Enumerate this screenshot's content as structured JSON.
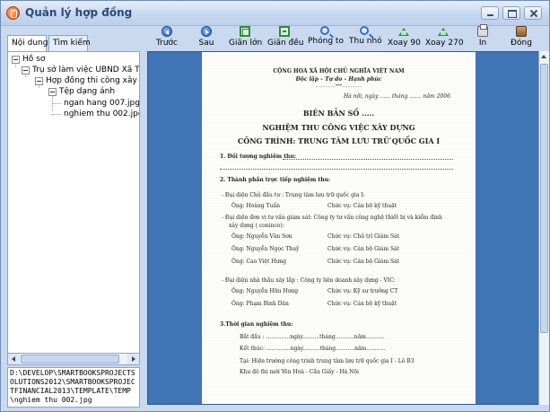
{
  "window": {
    "title": "Quản lý hợp đồng"
  },
  "tabs": [
    "Nội dung",
    "Tìm kiếm"
  ],
  "tree": {
    "root": "Hồ sơ",
    "level1": "Trụ sở làm việc UBND Xã Thần",
    "level2": "Hợp đồng thi công xây dựn",
    "level3": "Tệp dạng ảnh",
    "files": [
      "ngan hang 007.jpg",
      "nghiem thu 002.jpg"
    ]
  },
  "path_text": "D:\\DEVELOP\\SMARTBOOKSPROJECTSOLUTIONS2012\\SMARTBOOKSPROJECTFINANCIAL2013\\TEMPLATE\\TEMP\\nghiem thu 002.jpg",
  "toolbar": {
    "prev": "Trước",
    "next": "Sau",
    "zoom_in": "Giãn lớn",
    "fit": "Giãn đều",
    "magnify": "Phóng to",
    "shrink": "Thu nhỏ",
    "rotate90": "Xoay 90",
    "rotate270": "Xoay 270",
    "print": "In",
    "close": "Đóng"
  },
  "document": {
    "country": "CỘNG HOÀ XÃ HỘI CHỦ NGHĨA VIỆT NAM",
    "motto": "Độc lập – Tự do – Hạnh phúc",
    "motto_line": "..............***..............",
    "date": "Hà nội, ngày ...... tháng ....... năm 2006",
    "heading": "BIÊN BẢN SỐ .....",
    "subheading": "NGHIỆM THU CÔNG VIỆC XÂY DỰNG",
    "project": "CÔNG TRÌNH: TRUNG TÂM LƯU TRỮ QUỐC GIA I",
    "s1": "1. Đối tượng nghiệm thu:",
    "s2": "2. Thành phần trực tiếp nghiệm thu:",
    "owner_label": "- Đại diện Chủ đầu tư : Trung tâm lưu trữ quốc gia I:",
    "p1_name": "Ông: Hoàng Tuấn",
    "p1_role": "Chức vụ: Cán bộ kỹ thuật",
    "consult_label": "- Đại diện đơn vị tư vấn giám sát: Công ty tư vấn công nghệ thiết bị và kiểm định",
    "consult_label2": "xây dựng ( coninco):",
    "p2_name": "Ông: Nguyễn Văn Sơn",
    "p2_role": "Chức vụ: Chủ trì Giám Sát",
    "p3_name": "Ông: Nguyễn Ngọc Thuỷ",
    "p3_role": "Chức vụ: Cán bộ Giám Sát",
    "p4_name": "Ông: Cao Việt Hưng",
    "p4_role": "Chức vụ: Cán bộ Giám Sát",
    "contractor_label": "- Đại diện nhà thầu xây lắp : Công ty liên doanh xây dựng - VIC:",
    "p5_name": "Ông: Nguyễn Hữu Hưng",
    "p5_role": "Chức vụ: Kỹ sư trưởng CT",
    "p6_name": "Ông:  Phạm Bình Dân",
    "p6_role": "Chức vụ: Cán bộ kỹ thuật",
    "s3": "3.Thời gian nghiệm thu:",
    "start": "Bắt đầu : ..............ngày..........tháng...........năm...........",
    "end": "Kết thúc: ..............ngày..........tháng...........năm...........",
    "location": "Tại: Hiện trường công trình trung tâm lưu trữ quốc gia I - Lô B3",
    "location2": "Khu đô thị mới Yên Hoà - Cầu Giấy - Hà Nội"
  }
}
